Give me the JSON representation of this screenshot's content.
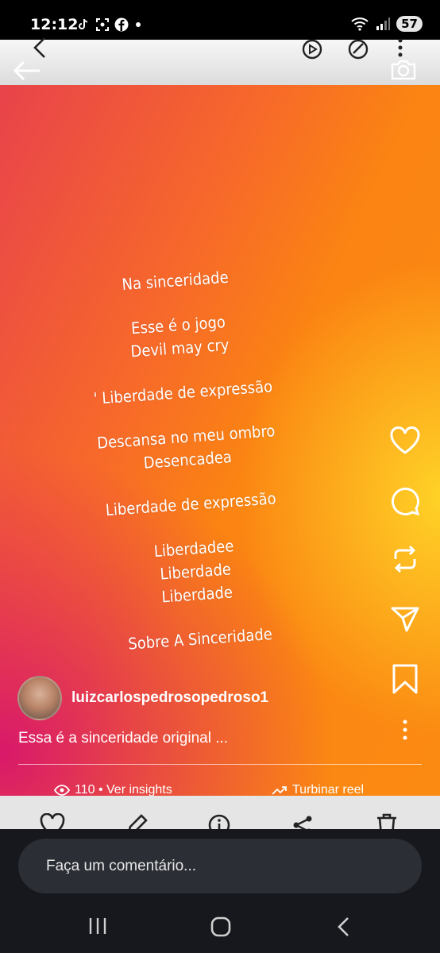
{
  "status": {
    "time": "12:12",
    "battery": "57"
  },
  "lyrics": [
    "Na sinceridade",
    "",
    "Esse é o jogo",
    "Devil may cry",
    "",
    "' Liberdade de expressão",
    "",
    "Descansa no meu ombro",
    "Desencadea",
    "",
    "Liberdade de expressão",
    "",
    "Liberdadee",
    "Liberdade",
    "Liberdade",
    "",
    "Sobre A Sinceridade"
  ],
  "post": {
    "username": "luizcarlospedrosopedroso1",
    "caption": "Essa é a sinceridade original ...",
    "insights": "110 • Ver insights",
    "boost": "Turbinar reel"
  },
  "comment": {
    "placeholder": "Faça um comentário..."
  },
  "icons": {
    "side": [
      "heart-icon",
      "comment-icon",
      "repost-icon",
      "send-icon",
      "bookmark-icon",
      "more-icon"
    ],
    "actions": [
      "heart-icon",
      "edit-icon",
      "info-icon",
      "share-icon",
      "trash-icon"
    ]
  }
}
